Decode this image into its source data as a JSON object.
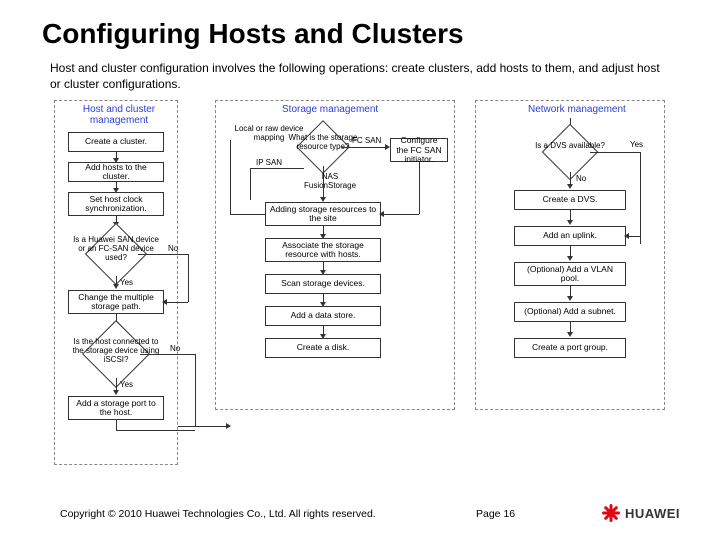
{
  "title": "Configuring Hosts and Clusters",
  "intro": "Host and cluster configuration involves the following operations: create clusters, add hosts to them, and adjust host or cluster configurations.",
  "columns": {
    "c1": "Host and cluster management",
    "c2": "Storage management",
    "c3": "Network management"
  },
  "col1": {
    "b1": "Create a cluster.",
    "b2": "Add hosts to the cluster.",
    "b3": "Set host clock synchronization.",
    "d1": "Is a Huawei SAN device or an FC-SAN device used?",
    "b4": "Change the multiple storage path.",
    "d2": "Is the host connected to the storage device using iSCSI?",
    "b5": "Add a storage port to the host."
  },
  "col2": {
    "label_top": "Local or raw device mapping",
    "d1": "What is the storage resource type?",
    "l1": "FC SAN",
    "l2": "IP SAN",
    "l3": "NAS FusionStorage",
    "b_fc": "Configure the FC SAN initiator.",
    "b1": "Adding storage resources to the site",
    "b2": "Associate the storage resource with hosts.",
    "b3": "Scan storage devices.",
    "b4": "Add a data store.",
    "b5": "Create a disk."
  },
  "col3": {
    "d1": "Is a DVS available?",
    "yes": "Yes",
    "no": "No",
    "b1": "Create a DVS.",
    "b2": "Add an uplink.",
    "b3": "(Optional) Add a VLAN pool.",
    "b4": "(Optional) Add a subnet.",
    "b5": "Create a port group."
  },
  "edges": {
    "yes": "Yes",
    "no": "No"
  },
  "footer": {
    "copyright": "Copyright © 2010 Huawei Technologies Co., Ltd. All rights reserved.",
    "page": "Page 16",
    "brand": "HUAWEI"
  }
}
